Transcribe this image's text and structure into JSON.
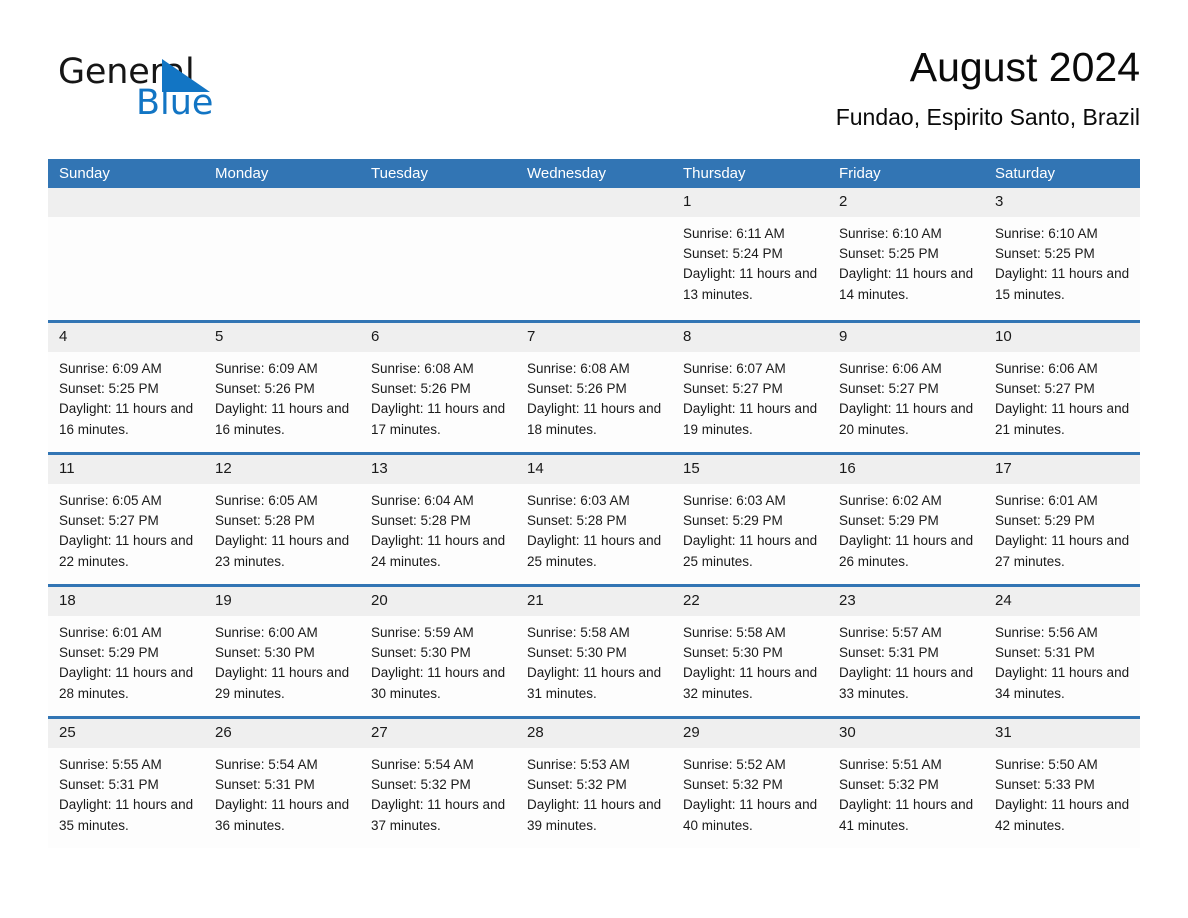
{
  "brand": {
    "name_part1": "General",
    "name_part2": "Blue",
    "triangle_color": "#1275c4"
  },
  "header": {
    "title": "August 2024",
    "subtitle": "Fundao, Espirito Santo, Brazil"
  },
  "colors": {
    "header_blue": "#3275b4",
    "day_band_gray": "#efefef",
    "text": "#1a1a1a"
  },
  "weekday_headers": [
    "Sunday",
    "Monday",
    "Tuesday",
    "Wednesday",
    "Thursday",
    "Friday",
    "Saturday"
  ],
  "weeks": [
    [
      {
        "day": "",
        "empty": true
      },
      {
        "day": "",
        "empty": true
      },
      {
        "day": "",
        "empty": true
      },
      {
        "day": "",
        "empty": true
      },
      {
        "day": "1",
        "sunrise": "Sunrise: 6:11 AM",
        "sunset": "Sunset: 5:24 PM",
        "daylight": "Daylight: 11 hours and 13 minutes."
      },
      {
        "day": "2",
        "sunrise": "Sunrise: 6:10 AM",
        "sunset": "Sunset: 5:25 PM",
        "daylight": "Daylight: 11 hours and 14 minutes."
      },
      {
        "day": "3",
        "sunrise": "Sunrise: 6:10 AM",
        "sunset": "Sunset: 5:25 PM",
        "daylight": "Daylight: 11 hours and 15 minutes."
      }
    ],
    [
      {
        "day": "4",
        "sunrise": "Sunrise: 6:09 AM",
        "sunset": "Sunset: 5:25 PM",
        "daylight": "Daylight: 11 hours and 16 minutes."
      },
      {
        "day": "5",
        "sunrise": "Sunrise: 6:09 AM",
        "sunset": "Sunset: 5:26 PM",
        "daylight": "Daylight: 11 hours and 16 minutes."
      },
      {
        "day": "6",
        "sunrise": "Sunrise: 6:08 AM",
        "sunset": "Sunset: 5:26 PM",
        "daylight": "Daylight: 11 hours and 17 minutes."
      },
      {
        "day": "7",
        "sunrise": "Sunrise: 6:08 AM",
        "sunset": "Sunset: 5:26 PM",
        "daylight": "Daylight: 11 hours and 18 minutes."
      },
      {
        "day": "8",
        "sunrise": "Sunrise: 6:07 AM",
        "sunset": "Sunset: 5:27 PM",
        "daylight": "Daylight: 11 hours and 19 minutes."
      },
      {
        "day": "9",
        "sunrise": "Sunrise: 6:06 AM",
        "sunset": "Sunset: 5:27 PM",
        "daylight": "Daylight: 11 hours and 20 minutes."
      },
      {
        "day": "10",
        "sunrise": "Sunrise: 6:06 AM",
        "sunset": "Sunset: 5:27 PM",
        "daylight": "Daylight: 11 hours and 21 minutes."
      }
    ],
    [
      {
        "day": "11",
        "sunrise": "Sunrise: 6:05 AM",
        "sunset": "Sunset: 5:27 PM",
        "daylight": "Daylight: 11 hours and 22 minutes."
      },
      {
        "day": "12",
        "sunrise": "Sunrise: 6:05 AM",
        "sunset": "Sunset: 5:28 PM",
        "daylight": "Daylight: 11 hours and 23 minutes."
      },
      {
        "day": "13",
        "sunrise": "Sunrise: 6:04 AM",
        "sunset": "Sunset: 5:28 PM",
        "daylight": "Daylight: 11 hours and 24 minutes."
      },
      {
        "day": "14",
        "sunrise": "Sunrise: 6:03 AM",
        "sunset": "Sunset: 5:28 PM",
        "daylight": "Daylight: 11 hours and 25 minutes."
      },
      {
        "day": "15",
        "sunrise": "Sunrise: 6:03 AM",
        "sunset": "Sunset: 5:29 PM",
        "daylight": "Daylight: 11 hours and 25 minutes."
      },
      {
        "day": "16",
        "sunrise": "Sunrise: 6:02 AM",
        "sunset": "Sunset: 5:29 PM",
        "daylight": "Daylight: 11 hours and 26 minutes."
      },
      {
        "day": "17",
        "sunrise": "Sunrise: 6:01 AM",
        "sunset": "Sunset: 5:29 PM",
        "daylight": "Daylight: 11 hours and 27 minutes."
      }
    ],
    [
      {
        "day": "18",
        "sunrise": "Sunrise: 6:01 AM",
        "sunset": "Sunset: 5:29 PM",
        "daylight": "Daylight: 11 hours and 28 minutes."
      },
      {
        "day": "19",
        "sunrise": "Sunrise: 6:00 AM",
        "sunset": "Sunset: 5:30 PM",
        "daylight": "Daylight: 11 hours and 29 minutes."
      },
      {
        "day": "20",
        "sunrise": "Sunrise: 5:59 AM",
        "sunset": "Sunset: 5:30 PM",
        "daylight": "Daylight: 11 hours and 30 minutes."
      },
      {
        "day": "21",
        "sunrise": "Sunrise: 5:58 AM",
        "sunset": "Sunset: 5:30 PM",
        "daylight": "Daylight: 11 hours and 31 minutes."
      },
      {
        "day": "22",
        "sunrise": "Sunrise: 5:58 AM",
        "sunset": "Sunset: 5:30 PM",
        "daylight": "Daylight: 11 hours and 32 minutes."
      },
      {
        "day": "23",
        "sunrise": "Sunrise: 5:57 AM",
        "sunset": "Sunset: 5:31 PM",
        "daylight": "Daylight: 11 hours and 33 minutes."
      },
      {
        "day": "24",
        "sunrise": "Sunrise: 5:56 AM",
        "sunset": "Sunset: 5:31 PM",
        "daylight": "Daylight: 11 hours and 34 minutes."
      }
    ],
    [
      {
        "day": "25",
        "sunrise": "Sunrise: 5:55 AM",
        "sunset": "Sunset: 5:31 PM",
        "daylight": "Daylight: 11 hours and 35 minutes."
      },
      {
        "day": "26",
        "sunrise": "Sunrise: 5:54 AM",
        "sunset": "Sunset: 5:31 PM",
        "daylight": "Daylight: 11 hours and 36 minutes."
      },
      {
        "day": "27",
        "sunrise": "Sunrise: 5:54 AM",
        "sunset": "Sunset: 5:32 PM",
        "daylight": "Daylight: 11 hours and 37 minutes."
      },
      {
        "day": "28",
        "sunrise": "Sunrise: 5:53 AM",
        "sunset": "Sunset: 5:32 PM",
        "daylight": "Daylight: 11 hours and 39 minutes."
      },
      {
        "day": "29",
        "sunrise": "Sunrise: 5:52 AM",
        "sunset": "Sunset: 5:32 PM",
        "daylight": "Daylight: 11 hours and 40 minutes."
      },
      {
        "day": "30",
        "sunrise": "Sunrise: 5:51 AM",
        "sunset": "Sunset: 5:32 PM",
        "daylight": "Daylight: 11 hours and 41 minutes."
      },
      {
        "day": "31",
        "sunrise": "Sunrise: 5:50 AM",
        "sunset": "Sunset: 5:33 PM",
        "daylight": "Daylight: 11 hours and 42 minutes."
      }
    ]
  ]
}
